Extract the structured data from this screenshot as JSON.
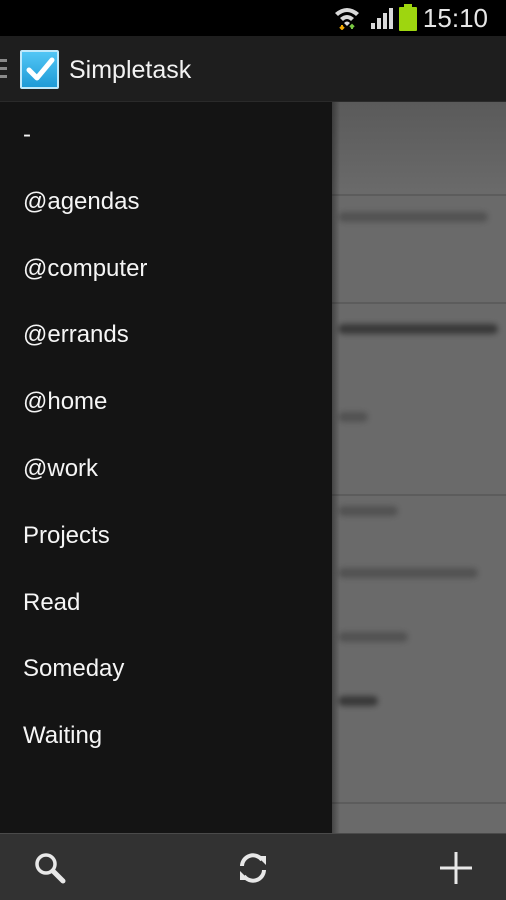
{
  "status_bar": {
    "time": "15:10",
    "icons": [
      "wifi-icon",
      "signal-icon",
      "battery-icon"
    ],
    "battery_color": "#9ed60f"
  },
  "action_bar": {
    "title": "Simpletask",
    "logo_icon": "checkbox-icon",
    "accent": "#33b5e5"
  },
  "drawer": {
    "items": [
      {
        "label": "-"
      },
      {
        "label": "@agendas"
      },
      {
        "label": "@computer"
      },
      {
        "label": "@errands"
      },
      {
        "label": "@home"
      },
      {
        "label": "@work"
      },
      {
        "label": "Projects"
      },
      {
        "label": "Read"
      },
      {
        "label": "Someday"
      },
      {
        "label": "Waiting"
      }
    ]
  },
  "bottom_bar": {
    "buttons": [
      {
        "icon": "search-icon"
      },
      {
        "icon": "sync-icon"
      },
      {
        "icon": "add-icon"
      }
    ]
  }
}
